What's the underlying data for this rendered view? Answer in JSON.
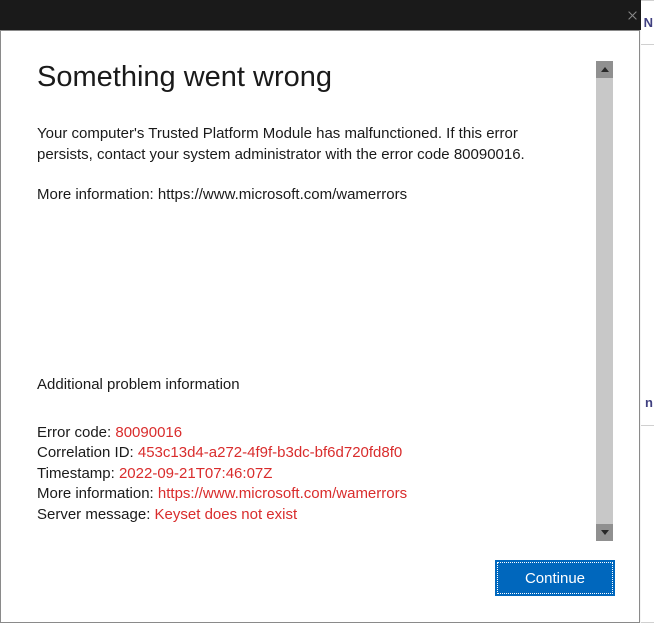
{
  "titlebar": {},
  "dialog": {
    "heading": "Something went wrong",
    "body_line1": "Your computer's Trusted Platform Module has malfunctioned. If this error persists, contact your system administrator with the error code 80090016.",
    "body_line2": "More information: https://www.microsoft.com/wamerrors",
    "subheading": "Additional problem information",
    "details": {
      "error_code_label": "Error code: ",
      "error_code_value": "80090016",
      "correlation_label": "Correlation ID: ",
      "correlation_value": "453c13d4-a272-4f9f-b3dc-bf6d720fd8f0",
      "timestamp_label": "Timestamp: ",
      "timestamp_value": "2022-09-21T07:46:07Z",
      "more_info_label": "More information: ",
      "more_info_value": "https://www.microsoft.com/wamerrors",
      "server_msg_label": "Server message: ",
      "server_msg_value": "Keyset does not exist"
    },
    "continue_button": "Continue"
  },
  "bg_fragments": {
    "f1": "N",
    "f2": "n"
  },
  "colors": {
    "accent": "#0067bd",
    "error_red": "#d92c2c"
  }
}
